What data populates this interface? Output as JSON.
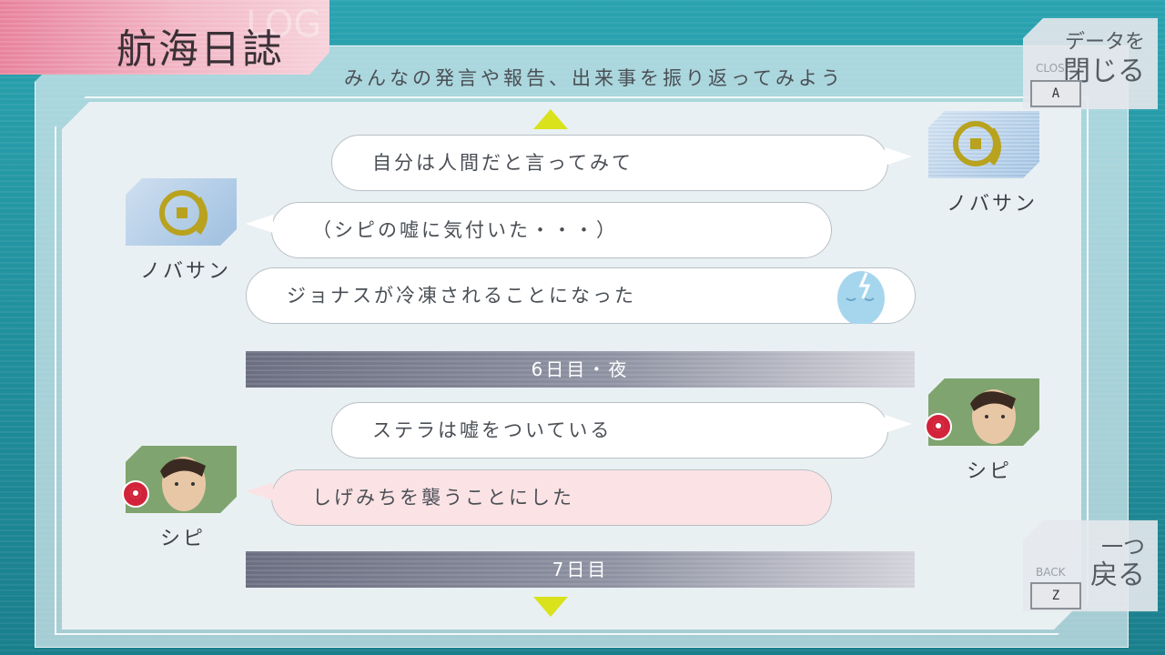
{
  "header": {
    "title": "航海日誌",
    "title_ghost": "LOG",
    "subtitle": "みんなの発言や報告、出来事を振り返ってみよう"
  },
  "buttons": {
    "close": {
      "label_line1": "データを",
      "label_line2": "閉じる",
      "small": "CLOSE",
      "key": "A"
    },
    "back": {
      "label_line1": "一つ",
      "label_line2": "戻る",
      "small": "BACK",
      "key": "Z"
    }
  },
  "log": {
    "entries": [
      {
        "type": "speech",
        "side": "right",
        "text": "自分は人間だと言ってみて",
        "speaker": "ノバサン"
      },
      {
        "type": "speech",
        "side": "left",
        "text": "（シピの嘘に気付いた・・・）",
        "speaker": "ノバサン"
      },
      {
        "type": "event",
        "text": "ジョナスが冷凍されることになった",
        "icon": "frozen-head-icon"
      },
      {
        "type": "day",
        "text": "6日目・夜"
      },
      {
        "type": "speech",
        "side": "right",
        "text": "ステラは嘘をついている",
        "speaker": "シピ"
      },
      {
        "type": "speech",
        "side": "left",
        "text": "しげみちを襲うことにした",
        "speaker": "シピ",
        "style": "pink"
      },
      {
        "type": "day",
        "text": "7日目"
      }
    ]
  },
  "colors": {
    "accent_arrow": "#d9e21b",
    "title_tab": "#e8839c",
    "pink_bubble": "#fbe3e5",
    "badge_red": "#d2233a",
    "background": "#1f8c99"
  }
}
